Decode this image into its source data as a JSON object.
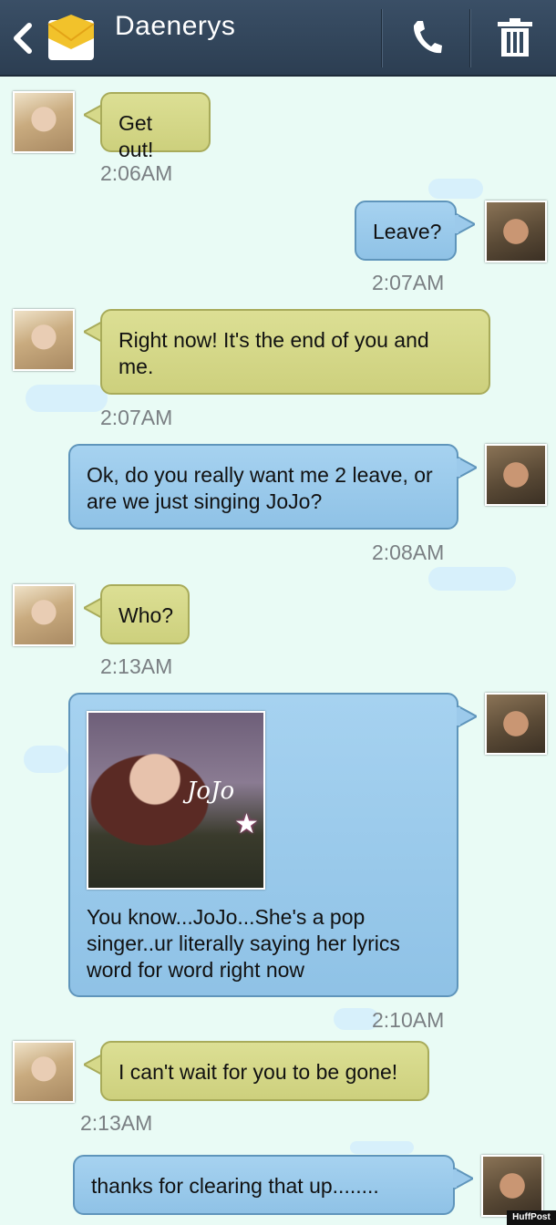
{
  "header": {
    "contact_name": "Daenerys"
  },
  "messages": [
    {
      "text": "Get out!",
      "time": "2:06AM"
    },
    {
      "text": "Leave?",
      "time": "2:07AM"
    },
    {
      "text": "Right now! It's the end of you and me.",
      "time": "2:07AM"
    },
    {
      "text": "Ok, do you really want me 2 leave, or are we just singing JoJo?",
      "time": "2:08AM"
    },
    {
      "text": "Who?",
      "time": "2:13AM"
    },
    {
      "text": "You know...JoJo...She's a pop singer..ur literally saying her lyrics word for word right now",
      "time": "2:10AM",
      "image_caption": "JoJo"
    },
    {
      "text": "I can't wait for you to be gone!",
      "time": "2:13AM"
    },
    {
      "text": "thanks for clearing that up........",
      "time": ""
    }
  ],
  "colors": {
    "header_bg": "#34495f",
    "background": "#e9fbf5",
    "incoming_bubble": "#d6d98a",
    "outgoing_bubble": "#9ccaeb",
    "timestamp": "#7a7f83"
  },
  "icons": {
    "back": "chevron-left-icon",
    "messages": "envelope-icon",
    "call": "phone-icon",
    "delete": "trash-icon"
  },
  "watermark": "HuffPost"
}
